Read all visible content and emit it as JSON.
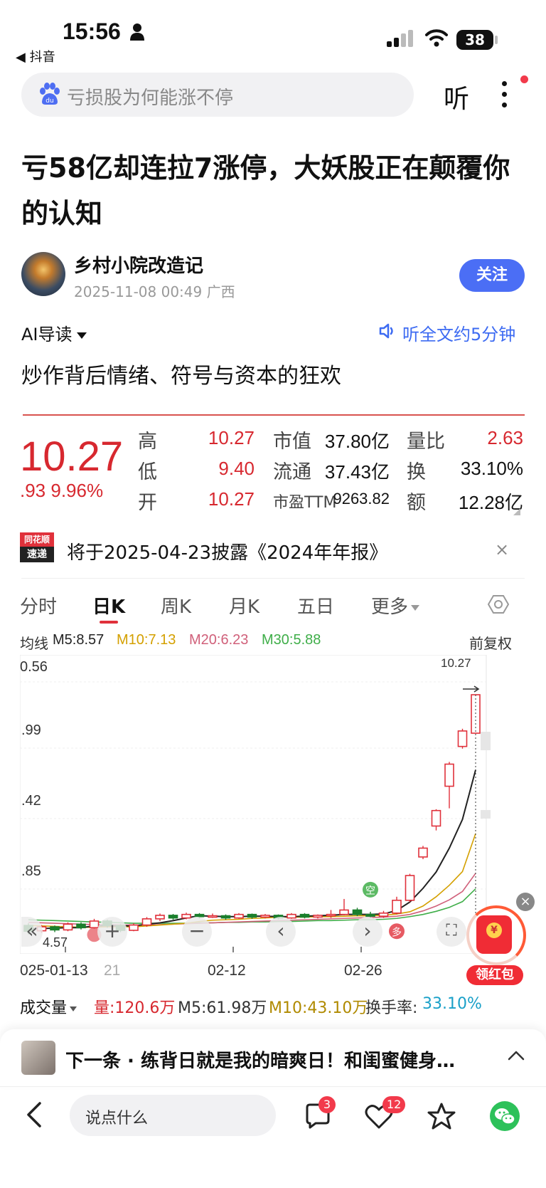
{
  "status_bar": {
    "time": "15:56",
    "back_app": "◀ 抖音",
    "battery": "38"
  },
  "search": {
    "placeholder": "亏损股为何能涨不停",
    "listen_label": "听"
  },
  "article": {
    "title": "亏58亿却连拉7涨停，大妖股正在颠覆你的认知",
    "author": "乡村小院改造记",
    "meta": "2025-11-08 00:49  广西",
    "follow_label": "关注",
    "ai_guide_label": "AI导读",
    "listen_full_label": "听全文约5分钟",
    "subtitle": "炒作背后情绪、符号与资本的狂欢"
  },
  "quote": {
    "price": "10.27",
    "change": ".93  9.96%",
    "rows": [
      {
        "l1": "高",
        "v1": "10.27",
        "l2": "市值",
        "v2": "37.80亿",
        "l3": "量比",
        "v3": "2.63"
      },
      {
        "l1": "低",
        "v1": "9.40",
        "l2": "流通",
        "v2": "37.43亿",
        "l3": "换",
        "v3": "33.10%"
      },
      {
        "l1": "开",
        "v1": "10.27",
        "l2": "市盈TTM",
        "v2": "9263.82",
        "l3": "额",
        "v3": "12.28亿"
      }
    ]
  },
  "disclosure": {
    "logo_top": "同花顺",
    "logo_bottom": "速递",
    "text": "将于2025-04-23披露《2024年年报》",
    "close": "×"
  },
  "tabs": [
    "分时",
    "日K",
    "周K",
    "月K",
    "五日",
    "更多"
  ],
  "ma_row": {
    "prefix": "均线",
    "m5": "M5:8.57",
    "m10": "M10:7.13",
    "m20": "M20:6.23",
    "m30": "M30:5.88",
    "adjust": "前复权",
    "colors": {
      "m5": "#222222",
      "m10": "#d4a000",
      "m20": "#d0607a",
      "m30": "#3fae49"
    }
  },
  "chart_data": {
    "type": "candlestick",
    "y_ticks": [
      "0.56",
      ".99",
      ".42",
      ".85"
    ],
    "y_min_label": "4.57",
    "max_label": "10.27",
    "x_labels": [
      "025-01-13",
      "21",
      "02-12",
      "02-26"
    ],
    "markers": {
      "sell": "空",
      "buy": "多"
    },
    "candles": [
      {
        "o": 5.05,
        "c": 4.92,
        "h": 5.1,
        "l": 4.85
      },
      {
        "o": 4.93,
        "c": 5.02,
        "h": 5.06,
        "l": 4.88
      },
      {
        "o": 5.02,
        "c": 4.95,
        "h": 5.05,
        "l": 4.9
      },
      {
        "o": 4.95,
        "c": 5.08,
        "h": 5.12,
        "l": 4.92
      },
      {
        "o": 5.08,
        "c": 5.0,
        "h": 5.12,
        "l": 4.96
      },
      {
        "o": 5.0,
        "c": 5.15,
        "h": 5.2,
        "l": 4.98
      },
      {
        "o": 5.15,
        "c": 5.05,
        "h": 5.18,
        "l": 5.0
      },
      {
        "o": 5.05,
        "c": 4.94,
        "h": 5.08,
        "l": 4.9
      },
      {
        "o": 4.94,
        "c": 5.06,
        "h": 5.1,
        "l": 4.92
      },
      {
        "o": 5.06,
        "c": 5.2,
        "h": 5.24,
        "l": 5.02
      },
      {
        "o": 5.2,
        "c": 5.28,
        "h": 5.32,
        "l": 5.15
      },
      {
        "o": 5.28,
        "c": 5.22,
        "h": 5.31,
        "l": 5.18
      },
      {
        "o": 5.22,
        "c": 5.3,
        "h": 5.34,
        "l": 5.19
      },
      {
        "o": 5.3,
        "c": 5.25,
        "h": 5.33,
        "l": 5.21
      },
      {
        "o": 5.25,
        "c": 5.27,
        "h": 5.32,
        "l": 5.22
      },
      {
        "o": 5.27,
        "c": 5.22,
        "h": 5.3,
        "l": 5.18
      },
      {
        "o": 5.22,
        "c": 5.3,
        "h": 5.33,
        "l": 5.2
      },
      {
        "o": 5.3,
        "c": 5.24,
        "h": 5.32,
        "l": 5.2
      },
      {
        "o": 5.24,
        "c": 5.28,
        "h": 5.31,
        "l": 5.21
      },
      {
        "o": 5.28,
        "c": 5.22,
        "h": 5.3,
        "l": 5.19
      },
      {
        "o": 5.22,
        "c": 5.3,
        "h": 5.33,
        "l": 5.2
      },
      {
        "o": 5.3,
        "c": 5.24,
        "h": 5.33,
        "l": 5.21
      },
      {
        "o": 5.24,
        "c": 5.28,
        "h": 5.3,
        "l": 5.21
      },
      {
        "o": 5.28,
        "c": 5.3,
        "h": 5.4,
        "l": 5.22
      },
      {
        "o": 5.3,
        "c": 5.4,
        "h": 5.65,
        "l": 5.28
      },
      {
        "o": 5.4,
        "c": 5.3,
        "h": 5.45,
        "l": 5.26
      },
      {
        "o": 5.3,
        "c": 5.26,
        "h": 5.36,
        "l": 5.22
      },
      {
        "o": 5.26,
        "c": 5.33,
        "h": 5.38,
        "l": 5.22
      },
      {
        "o": 5.33,
        "c": 5.62,
        "h": 5.7,
        "l": 5.3
      },
      {
        "o": 5.62,
        "c": 6.18,
        "h": 6.22,
        "l": 5.58
      },
      {
        "o": 6.6,
        "c": 6.8,
        "h": 6.85,
        "l": 6.55
      },
      {
        "o": 7.3,
        "c": 7.65,
        "h": 7.68,
        "l": 7.2
      },
      {
        "o": 8.2,
        "c": 8.7,
        "h": 8.75,
        "l": 7.7
      },
      {
        "o": 9.1,
        "c": 9.45,
        "h": 9.5,
        "l": 9.05
      },
      {
        "o": 9.4,
        "c": 10.27,
        "h": 10.27,
        "l": 9.4
      }
    ],
    "ma5": [
      4.98,
      4.98,
      4.99,
      5.0,
      5.0,
      5.04,
      5.05,
      5.04,
      5.04,
      5.08,
      5.11,
      5.16,
      5.22,
      5.27,
      5.26,
      5.25,
      5.25,
      5.26,
      5.26,
      5.25,
      5.25,
      5.26,
      5.27,
      5.28,
      5.3,
      5.3,
      5.3,
      5.31,
      5.39,
      5.58,
      5.89,
      6.26,
      6.8,
      7.45,
      8.57
    ],
    "ma10": [
      5.05,
      5.04,
      5.03,
      5.02,
      5.01,
      5.01,
      5.02,
      5.02,
      5.02,
      5.04,
      5.06,
      5.08,
      5.1,
      5.14,
      5.17,
      5.18,
      5.19,
      5.21,
      5.22,
      5.24,
      5.24,
      5.24,
      5.25,
      5.25,
      5.26,
      5.27,
      5.27,
      5.28,
      5.31,
      5.36,
      5.49,
      5.7,
      5.96,
      6.27,
      7.13
    ],
    "ma20": [
      5.12,
      5.11,
      5.1,
      5.09,
      5.08,
      5.07,
      5.07,
      5.06,
      5.06,
      5.06,
      5.07,
      5.08,
      5.09,
      5.1,
      5.11,
      5.12,
      5.13,
      5.14,
      5.15,
      5.16,
      5.17,
      5.18,
      5.19,
      5.2,
      5.21,
      5.22,
      5.23,
      5.24,
      5.26,
      5.3,
      5.38,
      5.49,
      5.63,
      5.82,
      6.23
    ],
    "ma30": [
      5.18,
      5.17,
      5.16,
      5.15,
      5.14,
      5.13,
      5.12,
      5.11,
      5.1,
      5.1,
      5.1,
      5.1,
      5.1,
      5.11,
      5.11,
      5.12,
      5.12,
      5.13,
      5.13,
      5.14,
      5.14,
      5.15,
      5.16,
      5.16,
      5.17,
      5.18,
      5.18,
      5.19,
      5.21,
      5.25,
      5.3,
      5.37,
      5.46,
      5.59,
      5.88
    ],
    "y_range": [
      4.57,
      10.56
    ]
  },
  "chart_controls": {
    "collapse": "«",
    "zoom_in": "+",
    "zoom_out": "−",
    "prev": "‹",
    "next": "›",
    "fullscreen": "⛶"
  },
  "volume_row": {
    "label": "成交量",
    "vol": "量:120.6万",
    "m5": "M5:61.98万",
    "m10": "M10:43.10万",
    "turnover_label": "换手率:",
    "turnover_value": "33.10%"
  },
  "red_packet": {
    "label": "领红包",
    "close": "×",
    "coin": "¥"
  },
  "next_bar": {
    "text": "下一条 · 练背日就是我的暗爽日！和闺蜜健身…"
  },
  "bottom_bar": {
    "comment_placeholder": "说点什么",
    "comment_count": "3",
    "like_count": "12"
  }
}
